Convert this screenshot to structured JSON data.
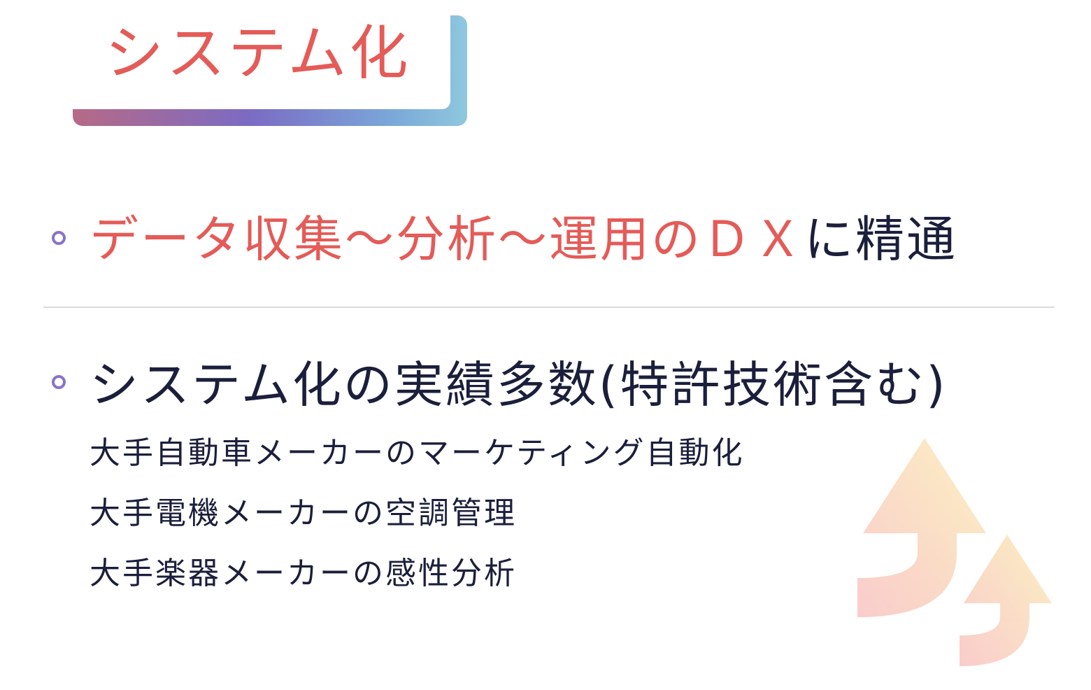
{
  "title": "システム化",
  "point1": {
    "highlight": "データ収集〜分析〜運用のＤＸ",
    "rest": "に精通"
  },
  "point2": {
    "heading": "システム化の実績多数(特許技術含む)",
    "items": [
      "大手自動車メーカーのマーケティング自動化",
      "大手電機メーカーの空調管理",
      "大手楽器メーカーの感性分析"
    ]
  },
  "colors": {
    "accent": "#e45b57",
    "text": "#1b1f3b",
    "bullet": "#8b73c6"
  },
  "icons": [
    "bullet-circle-icon",
    "up-arrow-icon"
  ]
}
